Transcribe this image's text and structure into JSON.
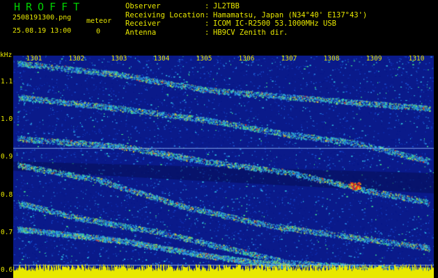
{
  "header": {
    "app_title": "HROFFT",
    "filename": "2508191300.png",
    "datetime": "25.08.19 13:00",
    "meteor_label": "meteor",
    "meteor_count": "0"
  },
  "info": [
    {
      "key": "Observer",
      "value": "JL2TBB"
    },
    {
      "key": "Receiving Location",
      "value": "Hamamatsu, Japan (N34°40' E137°43')"
    },
    {
      "key": "Receiver",
      "value": "ICOM IC-R2500 53.1000MHz USB"
    },
    {
      "key": "Antenna",
      "value": "HB9CV Zenith dir."
    }
  ],
  "colors": {
    "text": "#e8e800",
    "title": "#00d000",
    "background": "#000000",
    "spectrum_low": "#0a1a8a",
    "spectrum_high": "#e83020"
  },
  "chart_data": {
    "type": "heatmap",
    "ylabel": "kHz",
    "y_ticks": [
      "1.1",
      "1.0",
      "0.9",
      "0.8",
      "0.7",
      "0.6"
    ],
    "x_ticks": [
      "1301",
      "1302",
      "1303",
      "1304",
      "1305",
      "1306",
      "1307",
      "1308",
      "1309",
      "1310"
    ],
    "ylim": [
      0.58,
      1.17
    ],
    "xlim": [
      1300.5,
      1310.4
    ],
    "grid": false,
    "traces": [
      {
        "points": [
          [
            1300.6,
            1.06
          ],
          [
            1303.0,
            1.03
          ],
          [
            1305.0,
            1.0
          ],
          [
            1307.0,
            0.96
          ],
          [
            1308.5,
            0.94
          ],
          [
            1310.3,
            0.89
          ]
        ]
      },
      {
        "points": [
          [
            1300.6,
            1.15
          ],
          [
            1303.0,
            1.12
          ],
          [
            1305.0,
            1.08
          ],
          [
            1307.0,
            1.06
          ],
          [
            1310.3,
            1.03
          ]
        ]
      },
      {
        "points": [
          [
            1300.6,
            0.95
          ],
          [
            1303.0,
            0.93
          ],
          [
            1305.0,
            0.89
          ],
          [
            1307.0,
            0.86
          ],
          [
            1308.5,
            0.82
          ],
          [
            1310.3,
            0.78
          ]
        ]
      },
      {
        "points": [
          [
            1300.6,
            0.88
          ],
          [
            1302.5,
            0.84
          ],
          [
            1304.5,
            0.77
          ],
          [
            1306.5,
            0.72
          ],
          [
            1310.3,
            0.66
          ]
        ]
      },
      {
        "points": [
          [
            1300.6,
            0.78
          ],
          [
            1302.0,
            0.74
          ],
          [
            1304.0,
            0.7
          ],
          [
            1305.5,
            0.66
          ],
          [
            1307.0,
            0.62
          ],
          [
            1310.3,
            0.6
          ]
        ]
      },
      {
        "points": [
          [
            1300.6,
            0.71
          ],
          [
            1303.0,
            0.68
          ],
          [
            1305.0,
            0.64
          ],
          [
            1307.0,
            0.61
          ]
        ]
      }
    ],
    "flat_lines": [
      0.925,
      0.615
    ],
    "bright_spots": [
      [
        1308.55,
        0.825
      ]
    ]
  }
}
